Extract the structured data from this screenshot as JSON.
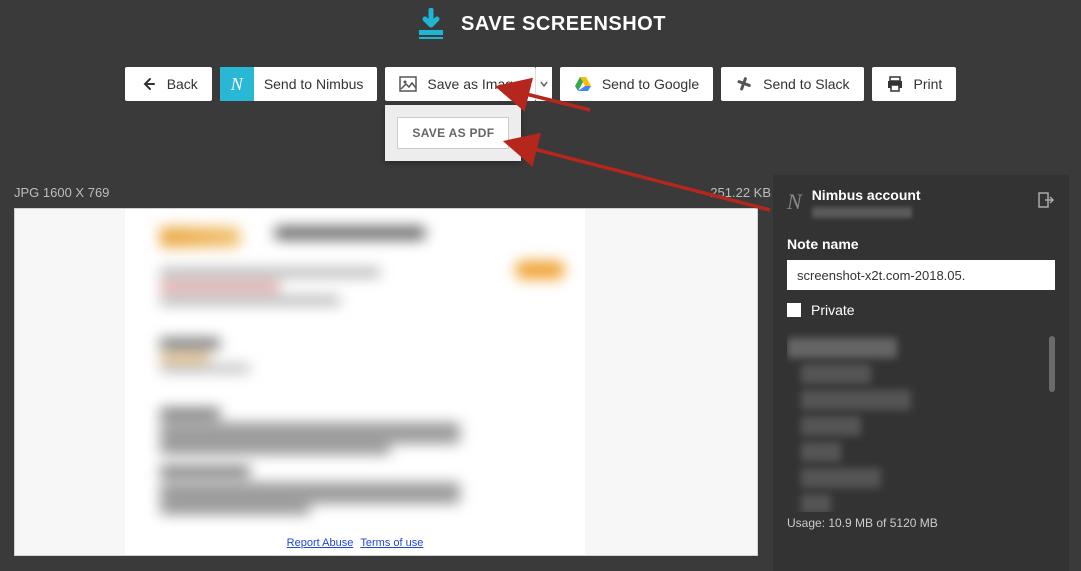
{
  "header": {
    "title": "SAVE SCREENSHOT"
  },
  "toolbar": {
    "back": "Back",
    "nimbus": "Send to Nimbus",
    "saveImage": "Save as Image",
    "google": "Send to Google",
    "slack": "Send to Slack",
    "print": "Print"
  },
  "dropdown": {
    "savePdf": "SAVE AS PDF"
  },
  "info": {
    "dimensions": "JPG 1600 X 769",
    "size": "251.22 KB"
  },
  "preview": {
    "footerLinks": {
      "reportAbuse": "Report Abuse",
      "terms": "Terms of use"
    }
  },
  "panel": {
    "accountTitle": "Nimbus account",
    "noteLabel": "Note name",
    "noteValue": "screenshot-x2t.com-2018.05.",
    "privateLabel": "Private",
    "usage": "Usage: 10.9 MB of 5120 MB"
  },
  "colors": {
    "accent": "#1fb6d6",
    "arrow": "#b5261d"
  }
}
